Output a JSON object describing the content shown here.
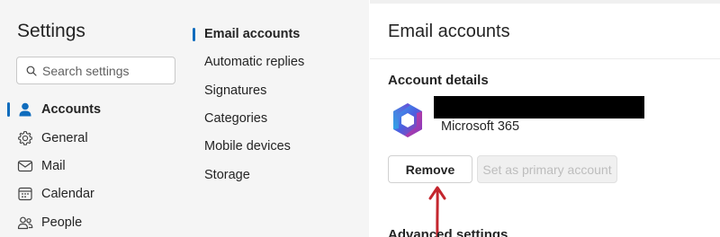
{
  "settings": {
    "title": "Settings",
    "search_placeholder": "Search settings",
    "nav_items": [
      {
        "label": "Accounts",
        "icon": "person-icon",
        "active": true
      },
      {
        "label": "General",
        "icon": "gear-icon",
        "active": false
      },
      {
        "label": "Mail",
        "icon": "mail-icon",
        "active": false
      },
      {
        "label": "Calendar",
        "icon": "calendar-icon",
        "active": false
      },
      {
        "label": "People",
        "icon": "people-icon",
        "active": false
      }
    ]
  },
  "accounts_menu": {
    "items": [
      {
        "label": "Email accounts",
        "active": true
      },
      {
        "label": "Automatic replies",
        "active": false
      },
      {
        "label": "Signatures",
        "active": false
      },
      {
        "label": "Categories",
        "active": false
      },
      {
        "label": "Mobile devices",
        "active": false
      },
      {
        "label": "Storage",
        "active": false
      }
    ]
  },
  "main": {
    "title": "Email accounts",
    "section_title": "Account details",
    "account_type": "Microsoft 365",
    "remove_label": "Remove",
    "primary_label": "Set as primary account",
    "advanced_title": "Advanced settings",
    "annotation_arrow_color": "#c4262e"
  },
  "colors": {
    "accent": "#0f6cbd",
    "panel_bg": "#f5f5f5"
  }
}
